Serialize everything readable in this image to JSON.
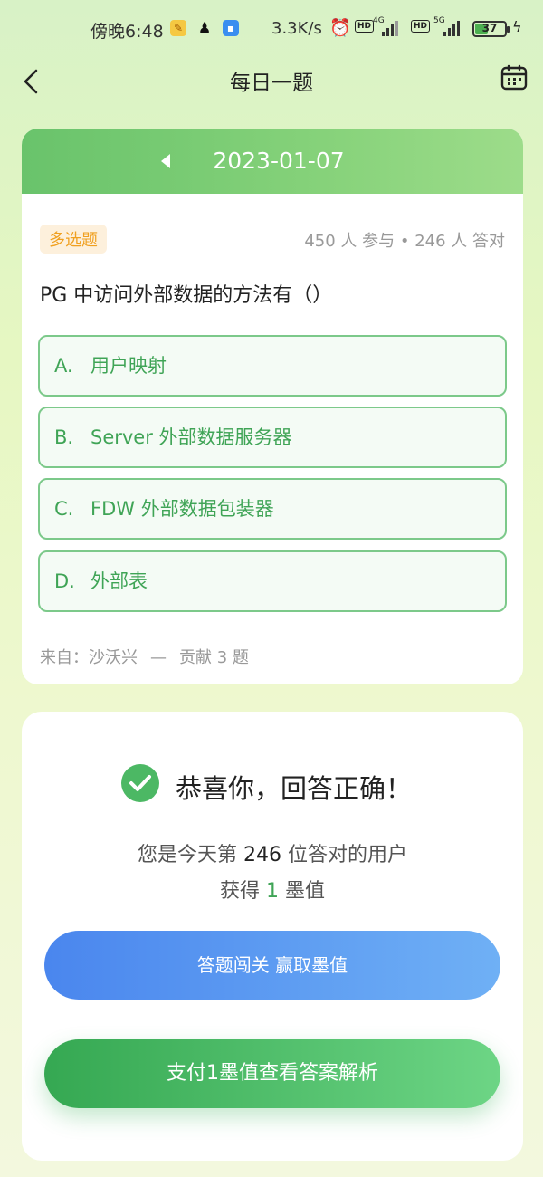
{
  "status_bar": {
    "time": "傍晚6:48",
    "net_speed": "3.3K/s",
    "network_1": "4G",
    "network_2": "5G",
    "hd": "HD",
    "battery": "37",
    "icons": [
      "app-icon-1",
      "qq-icon",
      "app-icon-2",
      "alarm-icon",
      "signal-icon",
      "battery-icon",
      "charging-icon"
    ]
  },
  "nav": {
    "title": "每日一题",
    "back_icon": "back-chevron-icon",
    "right_icon": "calendar-icon"
  },
  "question_card": {
    "date": "2023-01-07",
    "type_tag": "多选题",
    "stats": "450 人 参与 • 246 人 答对",
    "question": "PG 中访问外部数据的方法有（）",
    "options": [
      {
        "letter": "A.",
        "text": "用户映射"
      },
      {
        "letter": "B.",
        "text": "Server 外部数据服务器"
      },
      {
        "letter": "C.",
        "text": "FDW 外部数据包装器"
      },
      {
        "letter": "D.",
        "text": "外部表"
      }
    ],
    "source_label": "来自：沙沃兴",
    "source_sep": "—",
    "contribution": "贡献 3 题"
  },
  "result_card": {
    "title": "恭喜你，回答正确！",
    "line1_prefix": "您是今天第",
    "line1_number": "246",
    "line1_suffix": "位答对的用户",
    "line2_prefix": "获得",
    "line2_number": "1",
    "line2_suffix": "墨值",
    "btn_challenge": "答题闯关 赢取墨值",
    "btn_pay": "支付1墨值查看答案解析"
  },
  "colors": {
    "accent_green": "#3fa456",
    "tag_orange": "#f0a020",
    "button_blue": "#4a86ee"
  }
}
